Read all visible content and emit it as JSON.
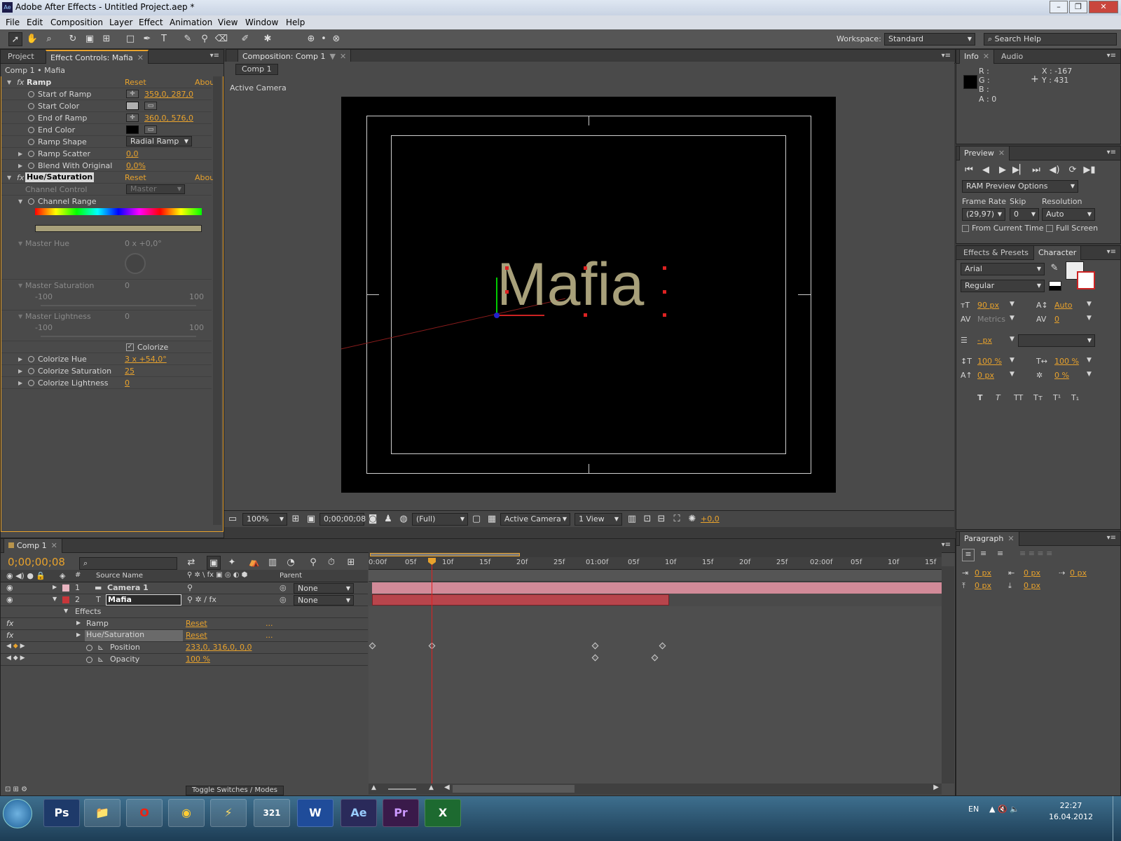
{
  "window": {
    "title": "Adobe After Effects - Untitled Project.aep *",
    "logo": "Ae",
    "buttons": [
      "–",
      "❐",
      "✕"
    ]
  },
  "menu": [
    "File",
    "Edit",
    "Composition",
    "Layer",
    "Effect",
    "Animation",
    "View",
    "Window",
    "Help"
  ],
  "workspace": {
    "label": "Workspace:",
    "value": "Standard",
    "search_placeholder": "Search Help"
  },
  "left_panel": {
    "tabs": [
      "Project",
      "Effect Controls: Mafia"
    ],
    "breadcrumb": "Comp 1 • Mafia",
    "effects": [
      {
        "name": "Ramp",
        "reset": "Reset",
        "about": "About"
      },
      {
        "name": "Hue/Saturation",
        "reset": "Reset",
        "about": "About"
      }
    ],
    "ramp_props": [
      {
        "label": "Start of Ramp",
        "value": "359,0, 287,0"
      },
      {
        "label": "Start Color",
        "value": ""
      },
      {
        "label": "End of Ramp",
        "value": "360,0, 576,0"
      },
      {
        "label": "End Color",
        "value": ""
      },
      {
        "label": "Ramp Shape",
        "value": "Radial Ramp"
      },
      {
        "label": "Ramp Scatter",
        "value": "0,0"
      },
      {
        "label": "Blend With Original",
        "value": "0,0%"
      }
    ],
    "channel_control": {
      "label": "Channel Control",
      "value": "Master"
    },
    "channel_range": "Channel Range",
    "master_hue": {
      "label": "Master Hue",
      "value": "0 x +0,0°"
    },
    "master_saturation": {
      "label": "Master Saturation",
      "value": "0",
      "min": "-100",
      "max": "100"
    },
    "master_lightness": {
      "label": "Master Lightness",
      "value": "0",
      "min": "-100",
      "max": "100"
    },
    "colorize": {
      "label": "Colorize",
      "checked": "✓"
    },
    "colorize_props": [
      {
        "label": "Colorize Hue",
        "value": "3 x +54,0°"
      },
      {
        "label": "Colorize Saturation",
        "value": "25"
      },
      {
        "label": "Colorize Lightness",
        "value": "0"
      }
    ]
  },
  "viewer": {
    "tab": "Composition: Comp 1",
    "comp_button": "Comp 1",
    "camera_label": "Active Camera",
    "text": "Mafia",
    "zoom": "100%",
    "timecode": "0;00;00;08",
    "resolution": "(Full)",
    "view": "Active Camera",
    "views": "1 View",
    "exposure": "+0,0"
  },
  "info": {
    "tabs": [
      "Info",
      "Audio"
    ],
    "r": "R :",
    "g": "G :",
    "b": "B :",
    "a": "A : 0",
    "x": "X : -167",
    "y": "Y : 431"
  },
  "preview": {
    "tab": "Preview",
    "ram_options": "RAM Preview Options",
    "frame_rate_label": "Frame Rate",
    "frame_rate": "(29,97)",
    "skip_label": "Skip",
    "skip": "0",
    "resolution_label": "Resolution",
    "resolution": "Auto",
    "from_current": "From Current Time",
    "full_screen": "Full Screen"
  },
  "character": {
    "tabs": [
      "Effects & Presets",
      "Character"
    ],
    "font": "Arial",
    "style": "Regular",
    "size": "90 px",
    "leading": "Auto",
    "kerning": "Metrics",
    "tracking": "0",
    "stroke": "- px",
    "vscale": "100 %",
    "hscale": "100 %",
    "baseline": "0 px",
    "tsume": "0 %",
    "style_buttons": [
      "T",
      "T",
      "TT",
      "Tт",
      "T¹",
      "T₁"
    ]
  },
  "timeline": {
    "tab": "Comp 1",
    "timecode": "0;00;00;08",
    "headers": [
      "#",
      "Source Name",
      "Parent"
    ],
    "ruler": [
      "0:00f",
      "05f",
      "10f",
      "15f",
      "20f",
      "25f",
      "01:00f",
      "05f",
      "10f",
      "15f",
      "20f",
      "25f",
      "02:00f",
      "05f",
      "10f",
      "15f"
    ],
    "layers": [
      {
        "num": "1",
        "name": "Camera 1",
        "parent": "None"
      },
      {
        "num": "2",
        "name": "Mafia",
        "parent": "None"
      }
    ],
    "effects_label": "Effects",
    "effect_rows": [
      {
        "name": "Ramp",
        "reset": "Reset",
        "dots": "..."
      },
      {
        "name": "Hue/Saturation",
        "reset": "Reset",
        "dots": "..."
      }
    ],
    "props": [
      {
        "name": "Position",
        "value": "233,0, 316,0, 0,0"
      },
      {
        "name": "Opacity",
        "value": "100 %"
      }
    ],
    "toggle_label": "Toggle Switches / Modes"
  },
  "paragraph": {
    "tab": "Paragraph",
    "indents": [
      "0 px",
      "0 px",
      "0 px",
      "0 px",
      "0 px"
    ]
  },
  "taskbar": {
    "apps": [
      "Ps",
      "📁",
      "O",
      "◉",
      "⚡",
      "321",
      "W",
      "Ae",
      "Pr",
      "X"
    ],
    "lang": "EN",
    "time": "22:27",
    "date": "16.04.2012"
  },
  "colors": {
    "accent": "#e8a22c",
    "camera_bar": "#d28a98",
    "mafia_bar": "#b8454c",
    "text": "#a8a07a"
  }
}
